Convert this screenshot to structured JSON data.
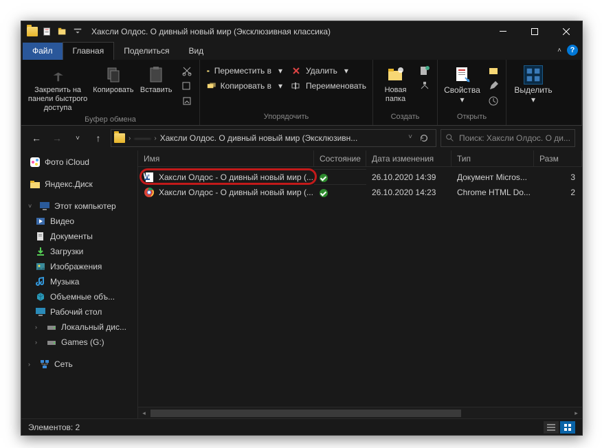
{
  "window": {
    "title": "Хаксли Олдос. О дивный новый мир (Эксклюзивная классика)"
  },
  "tabs": {
    "file": "Файл",
    "home": "Главная",
    "share": "Поделиться",
    "view": "Вид"
  },
  "ribbon": {
    "pin": "Закрепить на панели быстрого доступа",
    "copy": "Копировать",
    "paste": "Вставить",
    "clipboard_group": "Буфер обмена",
    "move_to": "Переместить в",
    "copy_to": "Копировать в",
    "delete": "Удалить",
    "rename": "Переименовать",
    "organize_group": "Упорядочить",
    "new_folder": "Новая папка",
    "create_group": "Создать",
    "properties": "Свойства",
    "open_group": "Открыть",
    "select": "Выделить",
    "chev": "▾"
  },
  "breadcrumbs": {
    "hidden": "——",
    "current": "Хаксли Олдос. О дивный новый мир (Эксклюзивн..."
  },
  "search": {
    "placeholder": "Поиск: Хаксли Олдос. О ди..."
  },
  "sidebar": {
    "icloud": "Фото iCloud",
    "yandex": "Яндекс.Диск",
    "this_pc": "Этот компьютер",
    "videos": "Видео",
    "documents": "Документы",
    "downloads": "Загрузки",
    "pictures": "Изображения",
    "music": "Музыка",
    "objects3d": "Объемные объ...",
    "desktop": "Рабочий стол",
    "local_disk": "Локальный дис...",
    "games": "Games (G:)",
    "network": "Сеть"
  },
  "columns": {
    "name": "Имя",
    "status": "Состояние",
    "date": "Дата изменения",
    "type": "Тип",
    "size": "Разм"
  },
  "files": [
    {
      "icon": "word",
      "name": "Хаксли Олдос - О дивный новый мир (...",
      "date": "26.10.2020 14:39",
      "type": "Документ Micros...",
      "size": "3"
    },
    {
      "icon": "chrome",
      "name": "Хаксли Олдос - О дивный новый мир (...",
      "date": "26.10.2020 14:23",
      "type": "Chrome HTML Do...",
      "size": "2"
    }
  ],
  "statusbar": {
    "count": "Элементов: 2"
  }
}
